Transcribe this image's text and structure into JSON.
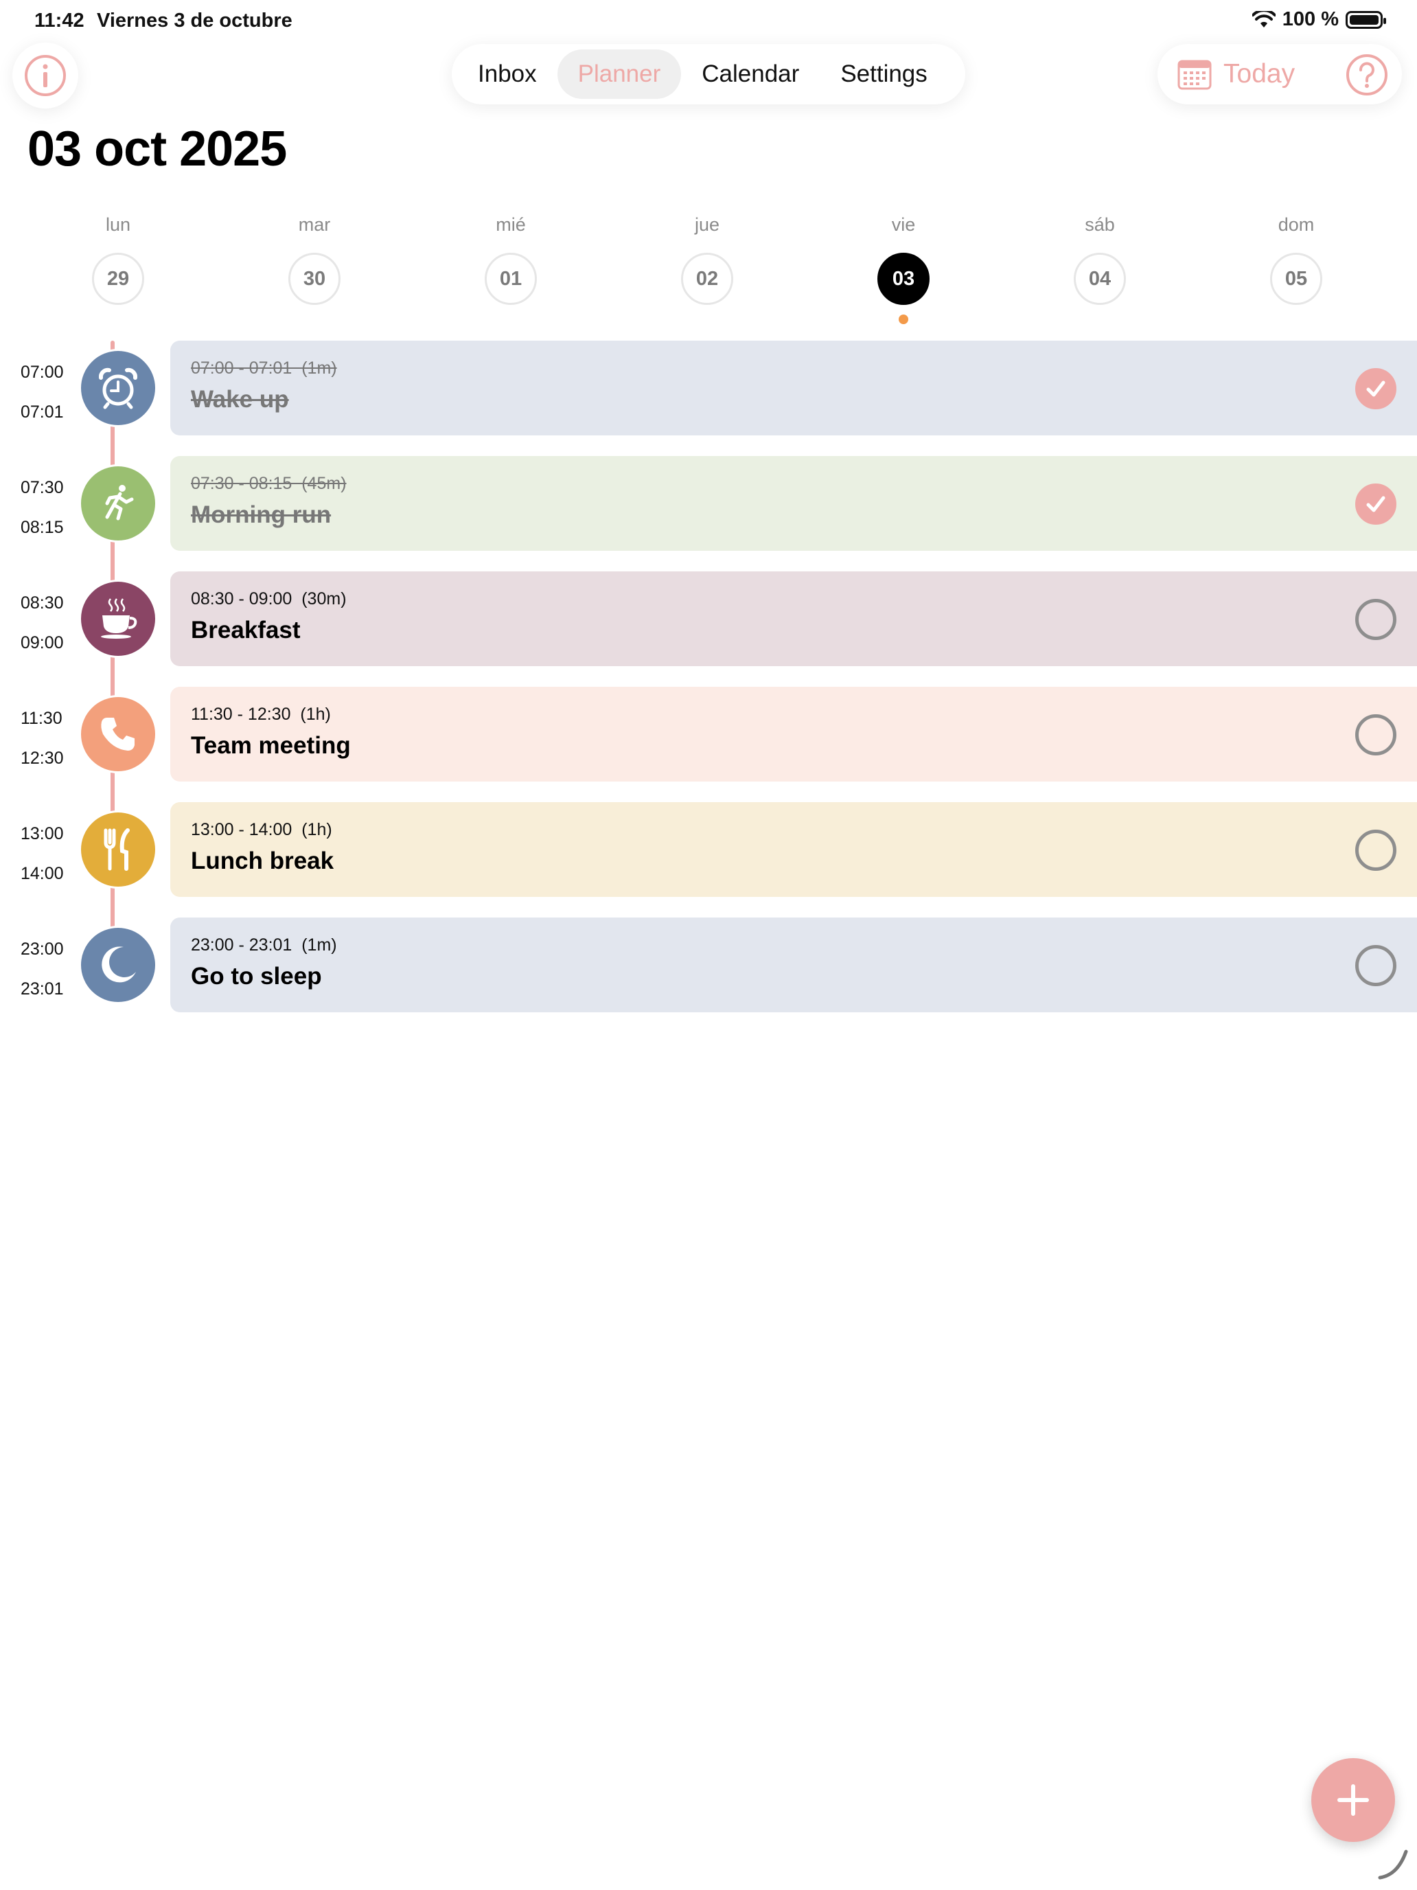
{
  "status": {
    "time": "11:42",
    "date": "Viernes 3 de octubre",
    "battery": "100 %"
  },
  "nav": {
    "tabs": [
      {
        "label": "Inbox",
        "active": false
      },
      {
        "label": "Planner",
        "active": true
      },
      {
        "label": "Calendar",
        "active": false
      },
      {
        "label": "Settings",
        "active": false
      }
    ],
    "today_label": "Today"
  },
  "title": "03 oct 2025",
  "week": [
    {
      "name": "lun",
      "num": "29"
    },
    {
      "name": "mar",
      "num": "30"
    },
    {
      "name": "mié",
      "num": "01"
    },
    {
      "name": "jue",
      "num": "02"
    },
    {
      "name": "vie",
      "num": "03",
      "selected": true
    },
    {
      "name": "sáb",
      "num": "04"
    },
    {
      "name": "dom",
      "num": "05"
    }
  ],
  "tasks": [
    {
      "start": "07:00",
      "end": "07:01",
      "meta": "07:00 - 07:01  (1m)",
      "title": "Wake up",
      "done": true,
      "icon": "alarm-clock-icon",
      "color": "#6a86ab",
      "card": "#e2e6ee"
    },
    {
      "start": "07:30",
      "end": "08:15",
      "meta": "07:30 - 08:15  (45m)",
      "title": "Morning run",
      "done": true,
      "icon": "running-icon",
      "color": "#9abf71",
      "card": "#eaf0e2"
    },
    {
      "start": "08:30",
      "end": "09:00",
      "meta": "08:30 - 09:00  (30m)",
      "title": "Breakfast",
      "done": false,
      "icon": "coffee-cup-icon",
      "color": "#8a4565",
      "card": "#e8dce0"
    },
    {
      "start": "11:30",
      "end": "12:30",
      "meta": "11:30 - 12:30  (1h)",
      "title": "Team meeting",
      "done": false,
      "icon": "phone-icon",
      "color": "#f3a07c",
      "card": "#fcebe5"
    },
    {
      "start": "13:00",
      "end": "14:00",
      "meta": "13:00 - 14:00  (1h)",
      "title": "Lunch break",
      "done": false,
      "icon": "fork-knife-icon",
      "color": "#e3ad3a",
      "card": "#f8eed8"
    },
    {
      "start": "23:00",
      "end": "23:01",
      "meta": "23:00 - 23:01  (1m)",
      "title": "Go to sleep",
      "done": false,
      "icon": "moon-icon",
      "color": "#6a86ab",
      "card": "#e2e6ee"
    }
  ],
  "colors": {
    "accent": "#eea8a6",
    "today_dot": "#f39a4a",
    "check_ring": "#8e8e8e"
  }
}
